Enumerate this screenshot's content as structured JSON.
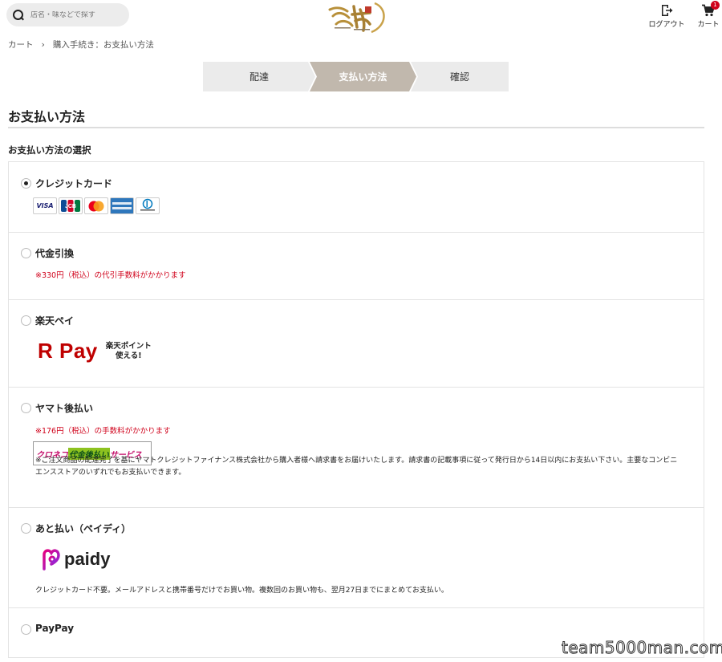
{
  "header": {
    "search_placeholder": "店名・味などで探す",
    "logout_label": "ログアウト",
    "cart_label": "カート",
    "cart_count": "1"
  },
  "breadcrumb": {
    "cart": "カート",
    "current": "購入手続き：お支払い方法"
  },
  "steps": [
    {
      "label": "配達",
      "active": false
    },
    {
      "label": "支払い方法",
      "active": true
    },
    {
      "label": "確認",
      "active": false
    }
  ],
  "page_title": "お支払い方法",
  "section_title": "お支払い方法の選択",
  "options": {
    "credit": {
      "label": "クレジットカード",
      "checked": true,
      "cards": [
        "VISA",
        "JCB",
        "Mastercard",
        "AMERICAN EXPRESS",
        "Diners Club"
      ]
    },
    "cod": {
      "label": "代金引換",
      "fee": "※330円（税込）の代引手数料がかかります"
    },
    "rakuten": {
      "label": "楽天ペイ",
      "logo_text": "R Pay",
      "logo_caption_1": "楽天ポイント",
      "logo_caption_2": "使える!"
    },
    "yamato": {
      "label": "ヤマト後払い",
      "fee": "※176円（税込）の手数料がかかります",
      "banner_part1": "クロネコ",
      "banner_part2": "代金後払い",
      "banner_part3": "サービス",
      "note_line1": "※ご注文商品の配達完了を基にヤマトクレジットファイナンス株式会社から購入者様へ請求書をお届けいたします。請求書の記載事項に従って発行日から14日以内にお支払い下さい。主要なコンビニ",
      "note_line2": "エンスストアのいずれでもお支払いできます。"
    },
    "paidy": {
      "label": "あと払い（ペイディ）",
      "logo_text": "paidy",
      "note": "クレジットカード不要。メールアドレスと携帯番号だけでお買い物。複数回のお買い物も、翌月27日までにまとめてお支払い。"
    },
    "paypay": {
      "label": "PayPay"
    }
  },
  "watermark": "team5000man.com",
  "colors": {
    "accent_red": "#d0021b",
    "step_active": "#c1b8ad",
    "step_inactive": "#ebebeb",
    "logo_gold": "#c9a24a"
  }
}
